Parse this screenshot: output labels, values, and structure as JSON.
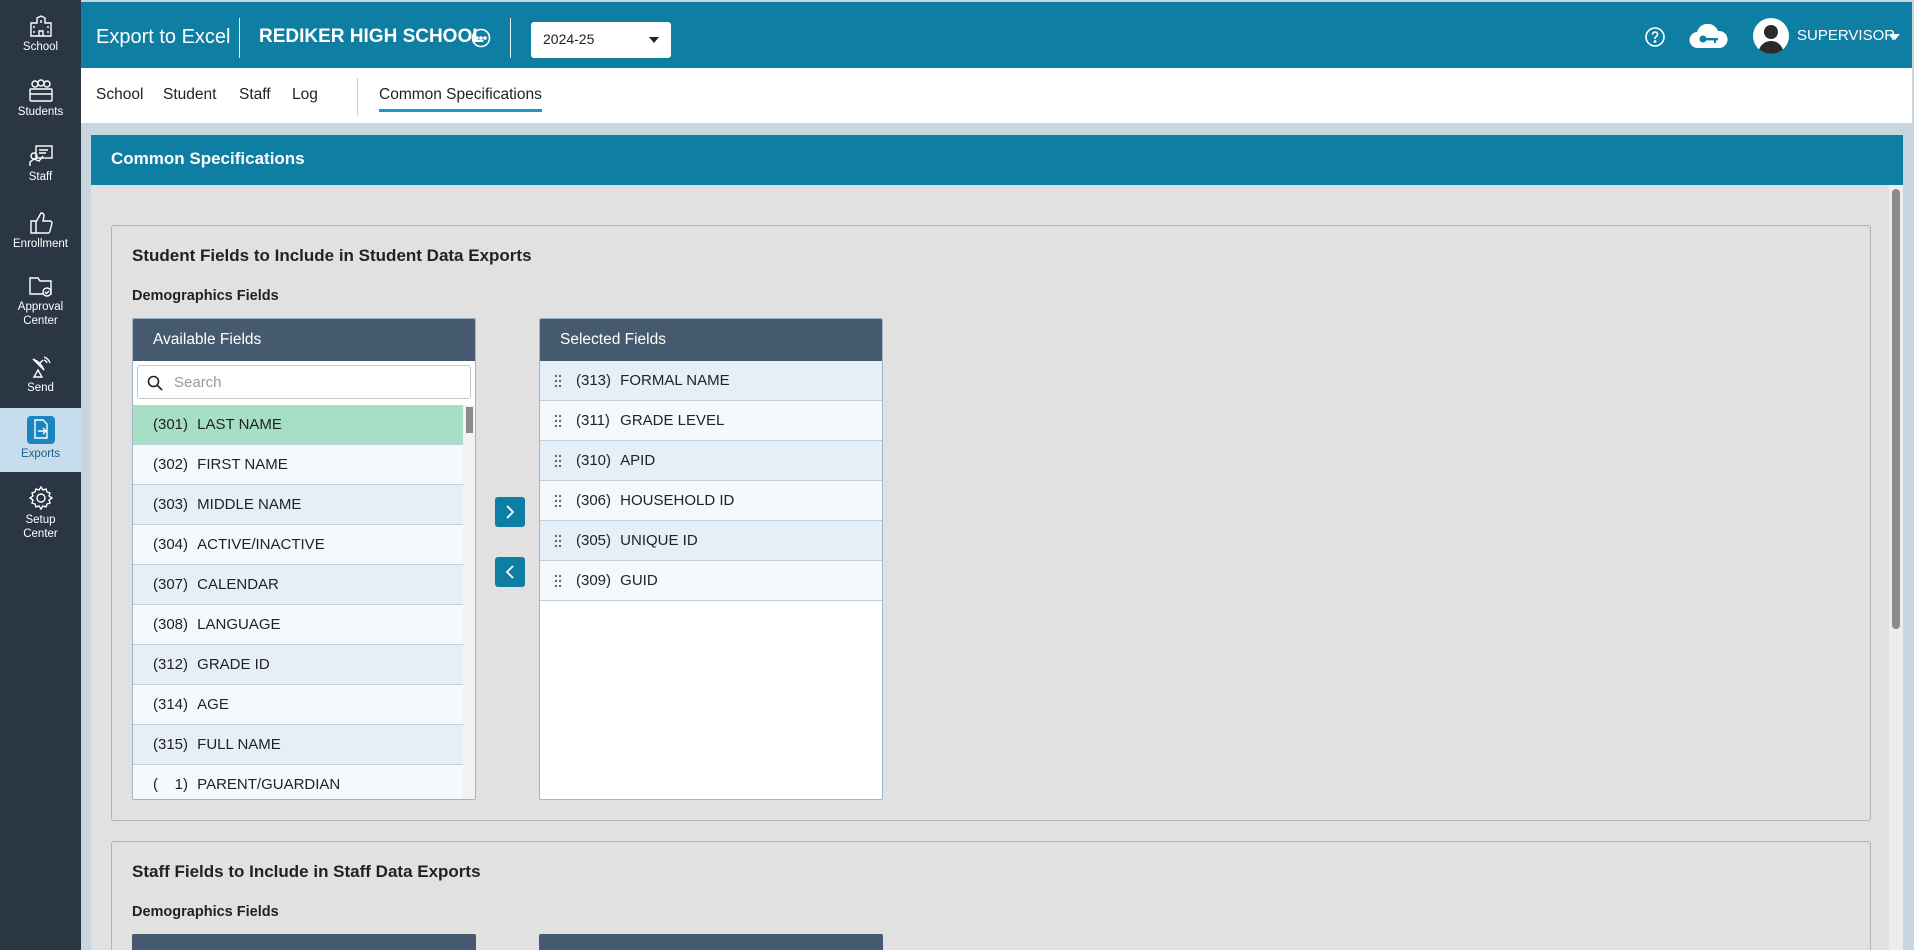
{
  "sidebar": {
    "items": [
      {
        "label": "School",
        "icon": "school-icon"
      },
      {
        "label": "Students",
        "icon": "students-icon"
      },
      {
        "label": "Staff",
        "icon": "staff-icon"
      },
      {
        "label": "Enrollment",
        "icon": "thumbs-up-icon"
      },
      {
        "label_line1": "Approval",
        "label_line2": "Center",
        "icon": "folder-check-icon"
      },
      {
        "label": "Send",
        "icon": "satellite-icon"
      },
      {
        "label": "Exports",
        "icon": "export-file-icon",
        "active": true
      },
      {
        "label_line1": "Setup",
        "label_line2": "Center",
        "icon": "gear-icon"
      }
    ]
  },
  "header": {
    "app_title": "Export to Excel",
    "school_name": "REDIKER HIGH SCHOOL",
    "year": "2024-25",
    "user": "SUPERVISOR"
  },
  "subnav": {
    "tabs": [
      {
        "label": "School"
      },
      {
        "label": "Student"
      },
      {
        "label": "Staff"
      },
      {
        "label": "Log"
      }
    ],
    "active_tab": "Common Specifications"
  },
  "panel": {
    "title": "Common Specifications",
    "student_section": {
      "title": "Student Fields to Include in Student Data Exports",
      "subtitle": "Demographics Fields",
      "available": {
        "header": "Available Fields",
        "search_placeholder": "Search",
        "rows": [
          {
            "code": "(301)",
            "name": "LAST NAME"
          },
          {
            "code": "(302)",
            "name": "FIRST NAME"
          },
          {
            "code": "(303)",
            "name": "MIDDLE NAME"
          },
          {
            "code": "(304)",
            "name": "ACTIVE/INACTIVE"
          },
          {
            "code": "(307)",
            "name": "CALENDAR"
          },
          {
            "code": "(308)",
            "name": "LANGUAGE"
          },
          {
            "code": "(312)",
            "name": "GRADE ID"
          },
          {
            "code": "(314)",
            "name": "AGE"
          },
          {
            "code": "(315)",
            "name": "FULL NAME"
          },
          {
            "code": "(    1)",
            "name": "PARENT/GUARDIAN"
          }
        ]
      },
      "selected": {
        "header": "Selected Fields",
        "rows": [
          {
            "code": "(313)",
            "name": "FORMAL NAME"
          },
          {
            "code": "(311)",
            "name": "GRADE LEVEL"
          },
          {
            "code": "(310)",
            "name": "APID"
          },
          {
            "code": "(306)",
            "name": "HOUSEHOLD ID"
          },
          {
            "code": "(305)",
            "name": "UNIQUE ID"
          },
          {
            "code": "(309)",
            "name": "GUID"
          }
        ]
      }
    },
    "staff_section": {
      "title": "Staff Fields to Include in Staff Data Exports",
      "subtitle": "Demographics Fields"
    }
  },
  "colors": {
    "brand": "#0f7ea3",
    "sidebar": "#2b3644",
    "list_header": "#455a6f",
    "highlight_row": "#a6dfc6"
  }
}
